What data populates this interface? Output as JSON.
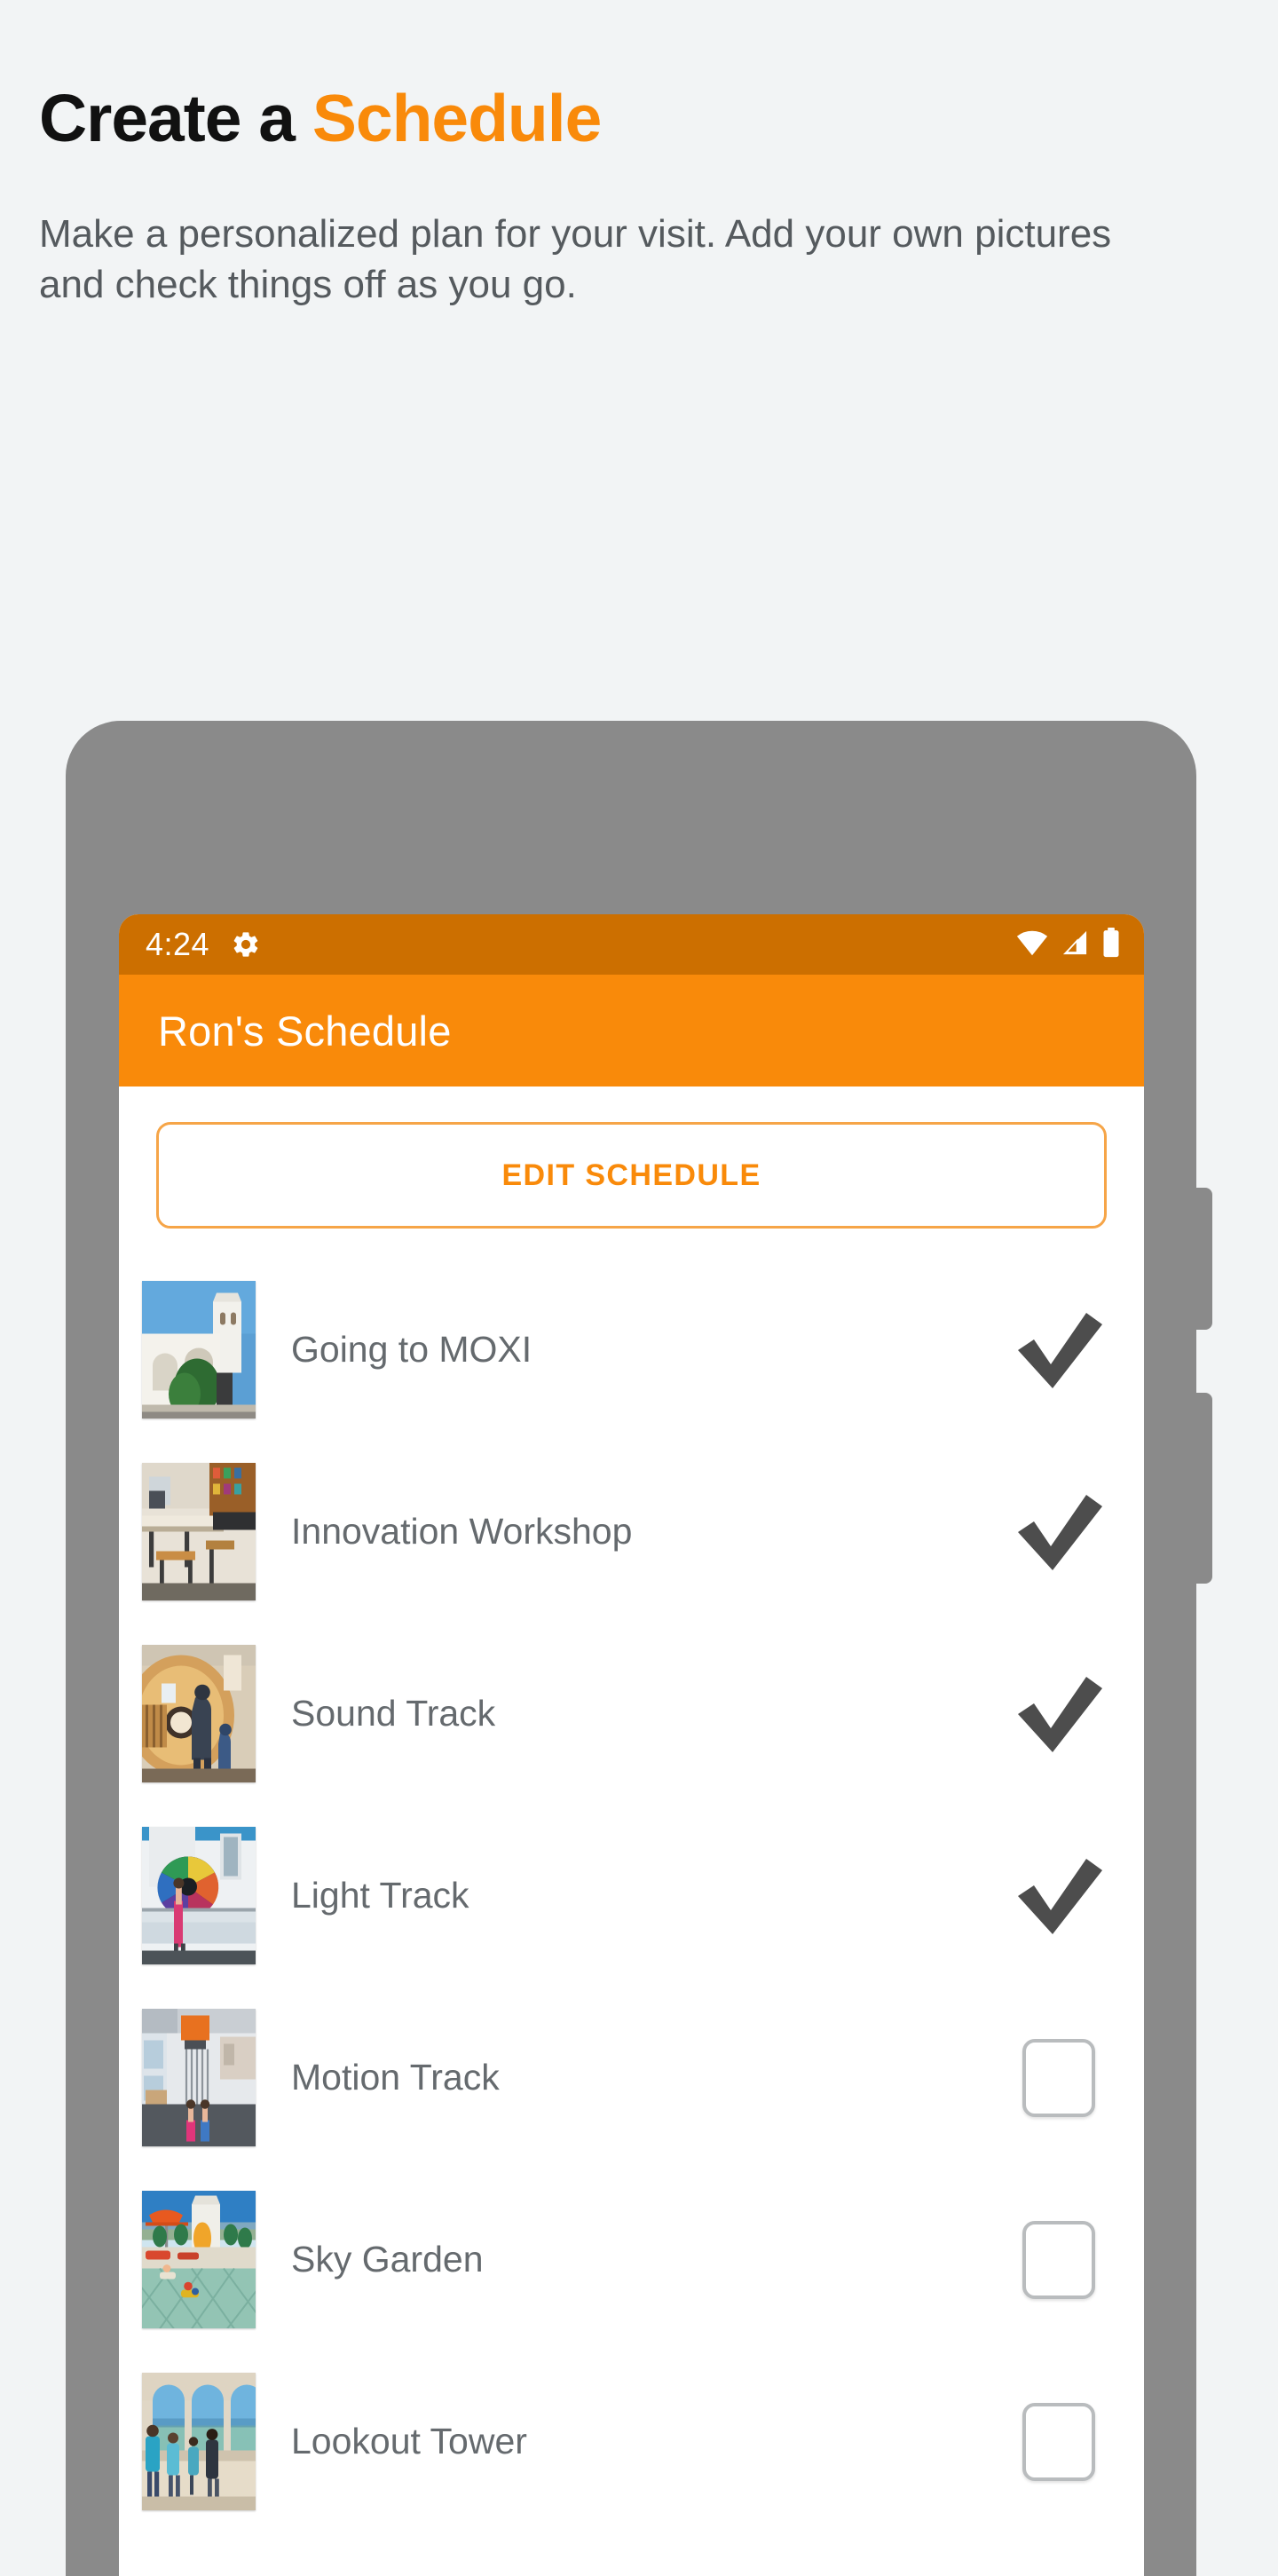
{
  "promo": {
    "title_plain": "Create a ",
    "title_accent": "Schedule",
    "subtitle": "Make a personalized plan for your visit. Add your own pictures and check things off as you go.",
    "accent_color": "#f98a0a"
  },
  "phone": {
    "status_bar": {
      "time": "4:24",
      "settings_icon": "gear-icon",
      "wifi_icon": "wifi-icon",
      "signal_icon": "cell-signal-icon",
      "battery_icon": "battery-icon",
      "background_color": "#cc6f00"
    },
    "app_bar": {
      "title": "Ron's Schedule",
      "background_color": "#f98a0a"
    },
    "edit_button": {
      "label": "EDIT SCHEDULE",
      "text_color": "#f98a0a",
      "border_color": "#f6a548"
    },
    "schedule_items": [
      {
        "title": "Going to MOXI",
        "checked": true,
        "thumbnail": "moxi-building-photo"
      },
      {
        "title": "Innovation Workshop",
        "checked": true,
        "thumbnail": "workshop-tables-photo"
      },
      {
        "title": "Sound Track",
        "checked": true,
        "thumbnail": "sound-guitar-wall-photo"
      },
      {
        "title": "Light Track",
        "checked": true,
        "thumbnail": "light-color-wheel-photo"
      },
      {
        "title": "Motion Track",
        "checked": false,
        "thumbnail": "motion-ball-tower-photo"
      },
      {
        "title": "Sky Garden",
        "checked": false,
        "thumbnail": "sky-garden-terrace-photo"
      },
      {
        "title": "Lookout Tower",
        "checked": false,
        "thumbnail": "lookout-tower-arches-photo"
      }
    ],
    "checkmark_color": "#4d4d4d",
    "checkbox_border_color": "#b9bcbe",
    "frame_color": "#8a8a8a"
  }
}
